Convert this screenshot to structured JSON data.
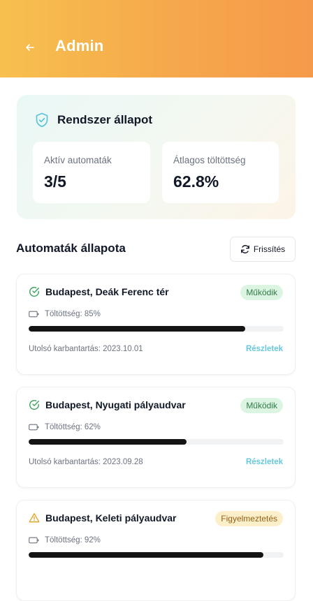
{
  "header": {
    "title": "Admin"
  },
  "status": {
    "title": "Rendszer állapot",
    "metrics": [
      {
        "label": "Aktív automaták",
        "value": "3/5"
      },
      {
        "label": "Átlagos töltöttség",
        "value": "62.8%"
      }
    ]
  },
  "machines_section": {
    "title": "Automaták állapota",
    "refresh_label": "Frissítés"
  },
  "machines": [
    {
      "name": "Budapest, Deák Ferenc tér",
      "status": "Működik",
      "status_type": "ok",
      "fill_label": "Töltöttség: 85%",
      "fill": 85,
      "maintenance": "Utolsó karbantartás: 2023.10.01",
      "details_label": "Részletek"
    },
    {
      "name": "Budapest, Nyugati pályaudvar",
      "status": "Működik",
      "status_type": "ok",
      "fill_label": "Töltöttség: 62%",
      "fill": 62,
      "maintenance": "Utolsó karbantartás: 2023.09.28",
      "details_label": "Részletek"
    },
    {
      "name": "Budapest, Keleti pályaudvar",
      "status": "Figyelmeztetés",
      "status_type": "warn",
      "fill_label": "Töltöttség: 92%",
      "fill": 92,
      "maintenance": "",
      "details_label": ""
    }
  ],
  "colors": {
    "accent_start": "#f7c04e",
    "accent_end": "#f59a4a",
    "ok": "#3aa35a",
    "warn": "#e0a528",
    "link": "#67c8df",
    "bar": "#141414"
  }
}
